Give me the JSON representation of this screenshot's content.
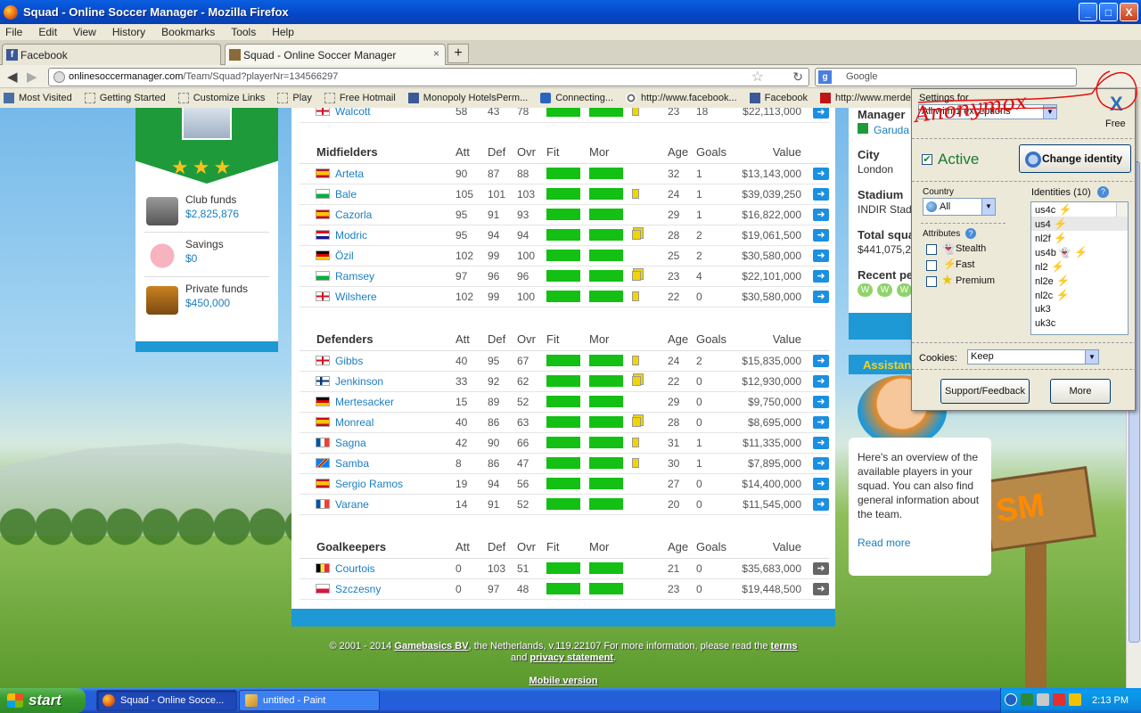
{
  "window": {
    "title": "Squad - Online Soccer Manager - Mozilla Firefox",
    "min": "_",
    "max": "□",
    "close": "X"
  },
  "menu": [
    "File",
    "Edit",
    "View",
    "History",
    "Bookmarks",
    "Tools",
    "Help"
  ],
  "tabs": [
    {
      "label": "Facebook",
      "close": "×"
    },
    {
      "label": "Squad - Online Soccer Manager",
      "close": "×"
    }
  ],
  "newtab": "+",
  "nav": {
    "url_domain": "onlinesoccermanager.com",
    "url_path": "/Team/Squad?playerNr=134566297",
    "search_placeholder": "Google"
  },
  "bookmarks": [
    "Most Visited",
    "Getting Started",
    "Customize Links",
    "Play",
    "Free Hotmail",
    "Monopoly HotelsPerm...",
    "Connecting...",
    "http://www.facebook...",
    "Facebook",
    "http://www.merdeka...."
  ],
  "left": {
    "club_funds_label": "Club funds",
    "club_funds": "$2,825,876",
    "savings_label": "Savings",
    "savings": "$0",
    "private_label": "Private funds",
    "private": "$450,000"
  },
  "columns": [
    "Att",
    "Def",
    "Ovr",
    "Fit",
    "Mor",
    "Age",
    "Goals",
    "Value"
  ],
  "top_row": {
    "name": "Walcott",
    "att": "58",
    "def": "43",
    "ovr": "78",
    "age": "23",
    "goals": "18",
    "value": "$22,113,000"
  },
  "groups": [
    {
      "title": "Midfielders",
      "players": [
        {
          "name": "Arteta",
          "flag": "es",
          "att": "90",
          "def": "87",
          "ovr": "88",
          "card": "",
          "age": "32",
          "goals": "1",
          "value": "$13,143,000"
        },
        {
          "name": "Bale",
          "flag": "wa",
          "att": "105",
          "def": "101",
          "ovr": "103",
          "card": "y",
          "age": "24",
          "goals": "1",
          "value": "$39,039,250"
        },
        {
          "name": "Cazorla",
          "flag": "es",
          "att": "95",
          "def": "91",
          "ovr": "93",
          "card": "",
          "age": "29",
          "goals": "1",
          "value": "$16,822,000"
        },
        {
          "name": "Modric",
          "flag": "hr",
          "att": "95",
          "def": "94",
          "ovr": "94",
          "card": "yy",
          "age": "28",
          "goals": "2",
          "value": "$19,061,500"
        },
        {
          "name": "Özil",
          "flag": "de",
          "att": "102",
          "def": "99",
          "ovr": "100",
          "card": "",
          "age": "25",
          "goals": "2",
          "value": "$30,580,000"
        },
        {
          "name": "Ramsey",
          "flag": "wa",
          "att": "97",
          "def": "96",
          "ovr": "96",
          "card": "yy",
          "age": "23",
          "goals": "4",
          "value": "$22,101,000"
        },
        {
          "name": "Wilshere",
          "flag": "en",
          "att": "102",
          "def": "99",
          "ovr": "100",
          "card": "y",
          "age": "22",
          "goals": "0",
          "value": "$30,580,000"
        }
      ]
    },
    {
      "title": "Defenders",
      "players": [
        {
          "name": "Gibbs",
          "flag": "en",
          "att": "40",
          "def": "95",
          "ovr": "67",
          "card": "y",
          "age": "24",
          "goals": "2",
          "value": "$15,835,000"
        },
        {
          "name": "Jenkinson",
          "flag": "fi",
          "att": "33",
          "def": "92",
          "ovr": "62",
          "card": "yy",
          "age": "22",
          "goals": "0",
          "value": "$12,930,000"
        },
        {
          "name": "Mertesacker",
          "flag": "de",
          "att": "15",
          "def": "89",
          "ovr": "52",
          "card": "",
          "age": "29",
          "goals": "0",
          "value": "$9,750,000"
        },
        {
          "name": "Monreal",
          "flag": "es",
          "att": "40",
          "def": "86",
          "ovr": "63",
          "card": "yy",
          "age": "28",
          "goals": "0",
          "value": "$8,695,000"
        },
        {
          "name": "Sagna",
          "flag": "fr",
          "att": "42",
          "def": "90",
          "ovr": "66",
          "card": "y",
          "age": "31",
          "goals": "1",
          "value": "$11,335,000"
        },
        {
          "name": "Samba",
          "flag": "cd",
          "att": "8",
          "def": "86",
          "ovr": "47",
          "card": "y",
          "age": "30",
          "goals": "1",
          "value": "$7,895,000"
        },
        {
          "name": "Sergio Ramos",
          "flag": "es",
          "att": "19",
          "def": "94",
          "ovr": "56",
          "card": "",
          "age": "27",
          "goals": "0",
          "value": "$14,400,000"
        },
        {
          "name": "Varane",
          "flag": "fr",
          "att": "14",
          "def": "91",
          "ovr": "52",
          "card": "",
          "age": "20",
          "goals": "0",
          "value": "$11,545,000"
        }
      ]
    },
    {
      "title": "Goalkeepers",
      "players": [
        {
          "name": "Courtois",
          "flag": "be",
          "att": "0",
          "def": "103",
          "ovr": "51",
          "card": "",
          "age": "21",
          "goals": "0",
          "value": "$35,683,000",
          "grey": true
        },
        {
          "name": "Szczesny",
          "flag": "pl",
          "att": "0",
          "def": "97",
          "ovr": "48",
          "card": "",
          "age": "23",
          "goals": "0",
          "value": "$19,448,500",
          "grey": true
        }
      ]
    }
  ],
  "footer": {
    "line1a": "© 2001 - 2014 ",
    "gb": "Gamebasics BV",
    "line1b": ", the Netherlands, v.119.22107 For more information, please read the ",
    "terms": "terms",
    "and": " and ",
    "privacy": "privacy statement",
    "dot": ".",
    "mobile": "Mobile version"
  },
  "right": {
    "manager_label": "Manager",
    "manager": "Garuda",
    "city_label": "City",
    "city": "London",
    "stadium_label": "Stadium",
    "stadium": "INDIR Stad",
    "total_label": "Total squad",
    "total": "$441,075,2",
    "recent_label": "Recent pe",
    "results": [
      "W",
      "W",
      "W"
    ]
  },
  "assistant": {
    "title": "Assistant",
    "text": "Here's an overview of the available players in your squad. You can also find general information about the team.",
    "read_more": "Read more",
    "sign": "SM"
  },
  "anonymox": {
    "settings_for": "Settings for",
    "settings_value": "All with 1 exceptions",
    "x": "X",
    "free": "Free",
    "active": "Active",
    "change_identity": "Change identity",
    "country_label": "Country",
    "country": "All",
    "identities_label": "Identities (10)",
    "identities": [
      {
        "id": "us4c",
        "bolt": true,
        "ghost": false
      },
      {
        "id": "us4",
        "bolt": true,
        "ghost": false
      },
      {
        "id": "nl2f",
        "bolt": true,
        "ghost": false
      },
      {
        "id": "us4b",
        "bolt": true,
        "ghost": true
      },
      {
        "id": "nl2",
        "bolt": true,
        "ghost": false
      },
      {
        "id": "nl2e",
        "bolt": true,
        "ghost": false
      },
      {
        "id": "nl2c",
        "bolt": true,
        "ghost": false
      },
      {
        "id": "uk3",
        "bolt": false,
        "ghost": false
      },
      {
        "id": "uk3c",
        "bolt": false,
        "ghost": false
      }
    ],
    "attributes_label": "Attributes",
    "attributes": [
      "Stealth",
      "Fast",
      "Premium"
    ],
    "cookies_label": "Cookies:",
    "cookies": "Keep",
    "support": "Support/Feedback",
    "more": "More",
    "scribble_text": "Anonymox"
  },
  "taskbar": {
    "start": "start",
    "tasks": [
      "Squad - Online Socce...",
      "untitled - Paint"
    ],
    "clock": "2:13 PM"
  }
}
